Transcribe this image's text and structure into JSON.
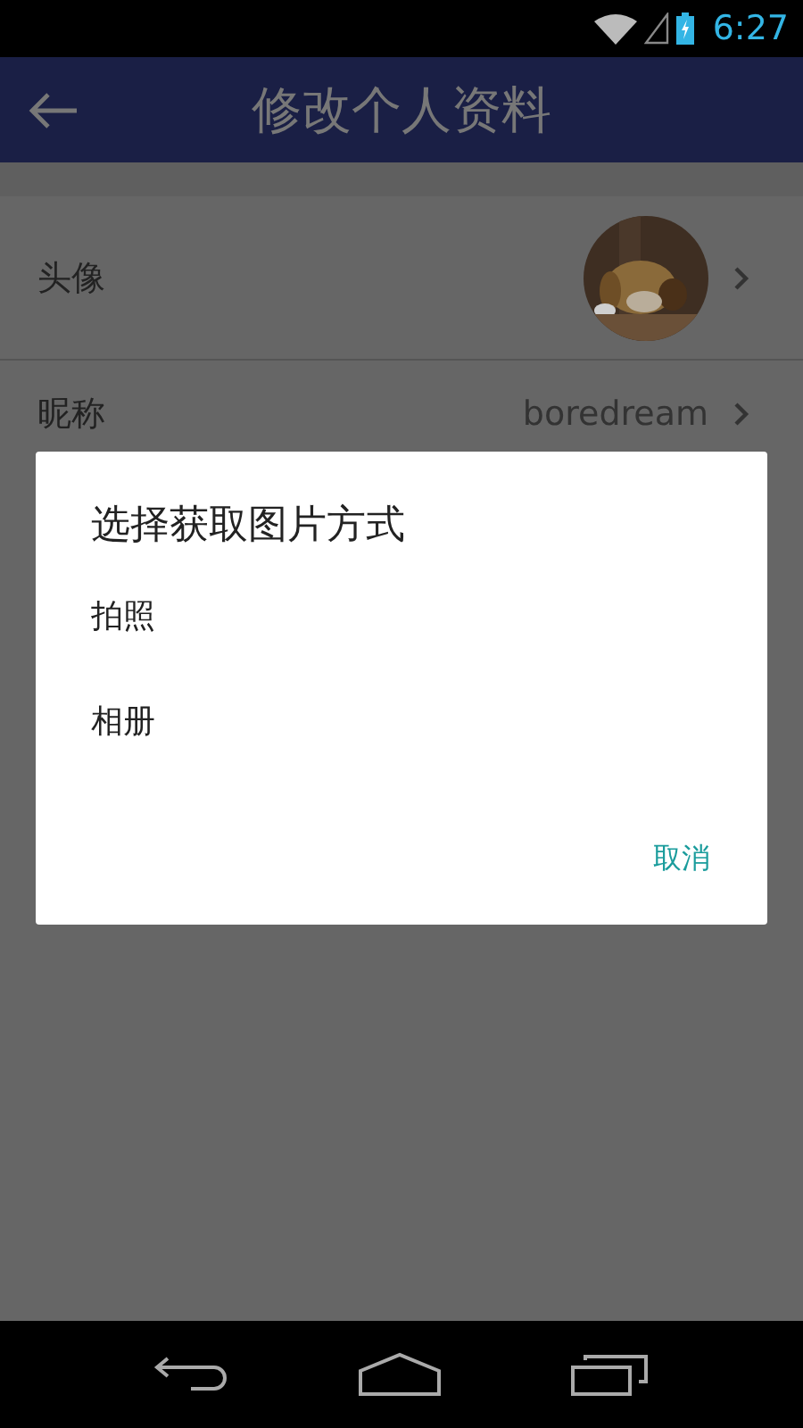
{
  "status_bar": {
    "time": "6:27"
  },
  "app_bar": {
    "title": "修改个人资料"
  },
  "rows": [
    {
      "kind": "avatar",
      "label": "头像"
    },
    {
      "kind": "text",
      "label": "昵称",
      "value": "boredream"
    }
  ],
  "dialog": {
    "title": "选择获取图片方式",
    "options": [
      "拍照",
      "相册"
    ],
    "cancel": "取消"
  }
}
